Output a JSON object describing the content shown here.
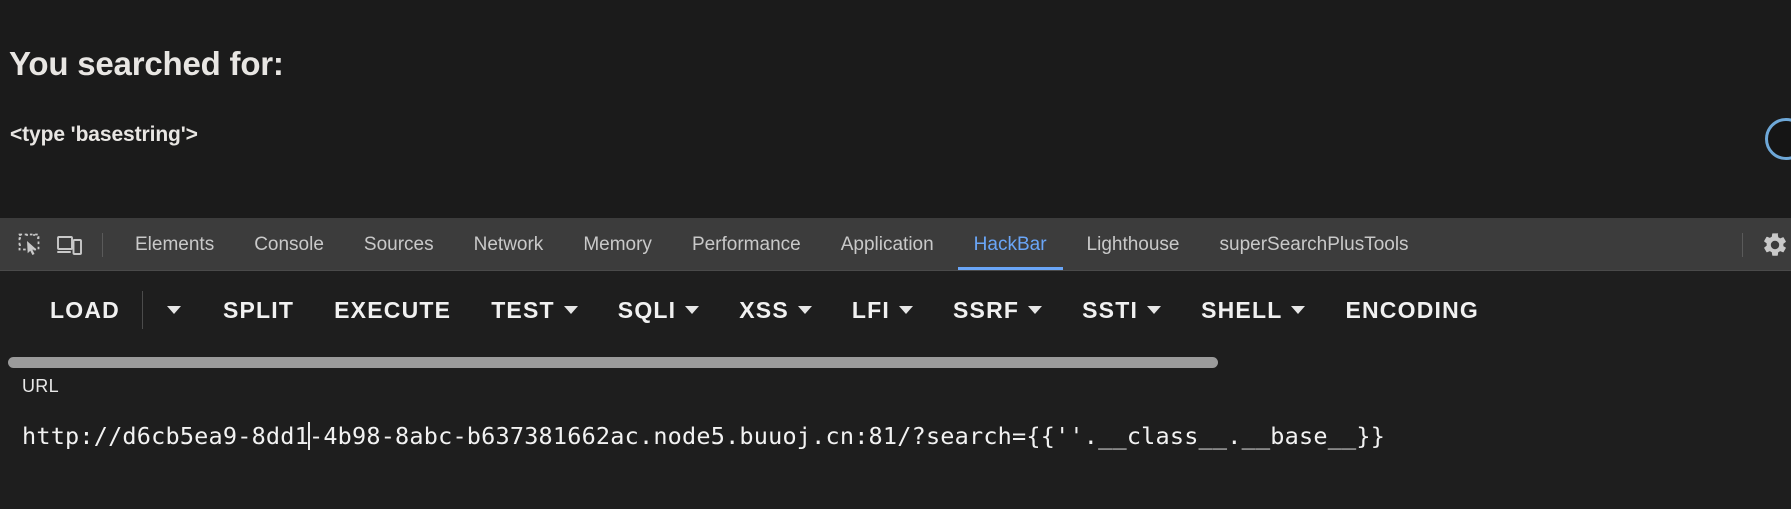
{
  "page": {
    "heading": "You searched for:",
    "result": "<type 'basestring'>"
  },
  "devtools": {
    "icons": {
      "inspect": "inspect-element-icon",
      "device": "device-toolbar-icon",
      "settings": "gear-icon"
    },
    "tabs": [
      {
        "label": "Elements",
        "active": false
      },
      {
        "label": "Console",
        "active": false
      },
      {
        "label": "Sources",
        "active": false
      },
      {
        "label": "Network",
        "active": false
      },
      {
        "label": "Memory",
        "active": false
      },
      {
        "label": "Performance",
        "active": false
      },
      {
        "label": "Application",
        "active": false
      },
      {
        "label": "HackBar",
        "active": true
      },
      {
        "label": "Lighthouse",
        "active": false
      },
      {
        "label": "superSearchPlusTools",
        "active": false
      }
    ],
    "active_tab_color": "#6aa6f8"
  },
  "hackbar": {
    "buttons": [
      {
        "label": "LOAD",
        "caret": false
      },
      {
        "label": "",
        "caret": true
      },
      {
        "label": "SPLIT",
        "caret": false
      },
      {
        "label": "EXECUTE",
        "caret": false
      },
      {
        "label": "TEST",
        "caret": true
      },
      {
        "label": "SQLI",
        "caret": true
      },
      {
        "label": "XSS",
        "caret": true
      },
      {
        "label": "LFI",
        "caret": true
      },
      {
        "label": "SSRF",
        "caret": true
      },
      {
        "label": "SSTI",
        "caret": true
      },
      {
        "label": "SHELL",
        "caret": true
      },
      {
        "label": "ENCODING",
        "caret": false
      }
    ],
    "url_label": "URL",
    "url_before_caret": "http://d6cb5ea9-8dd1",
    "url_after_caret": "-4b98-8abc-b637381662ac.node5.buuoj.cn:81/?search={{''.__class__.__base__}}"
  }
}
